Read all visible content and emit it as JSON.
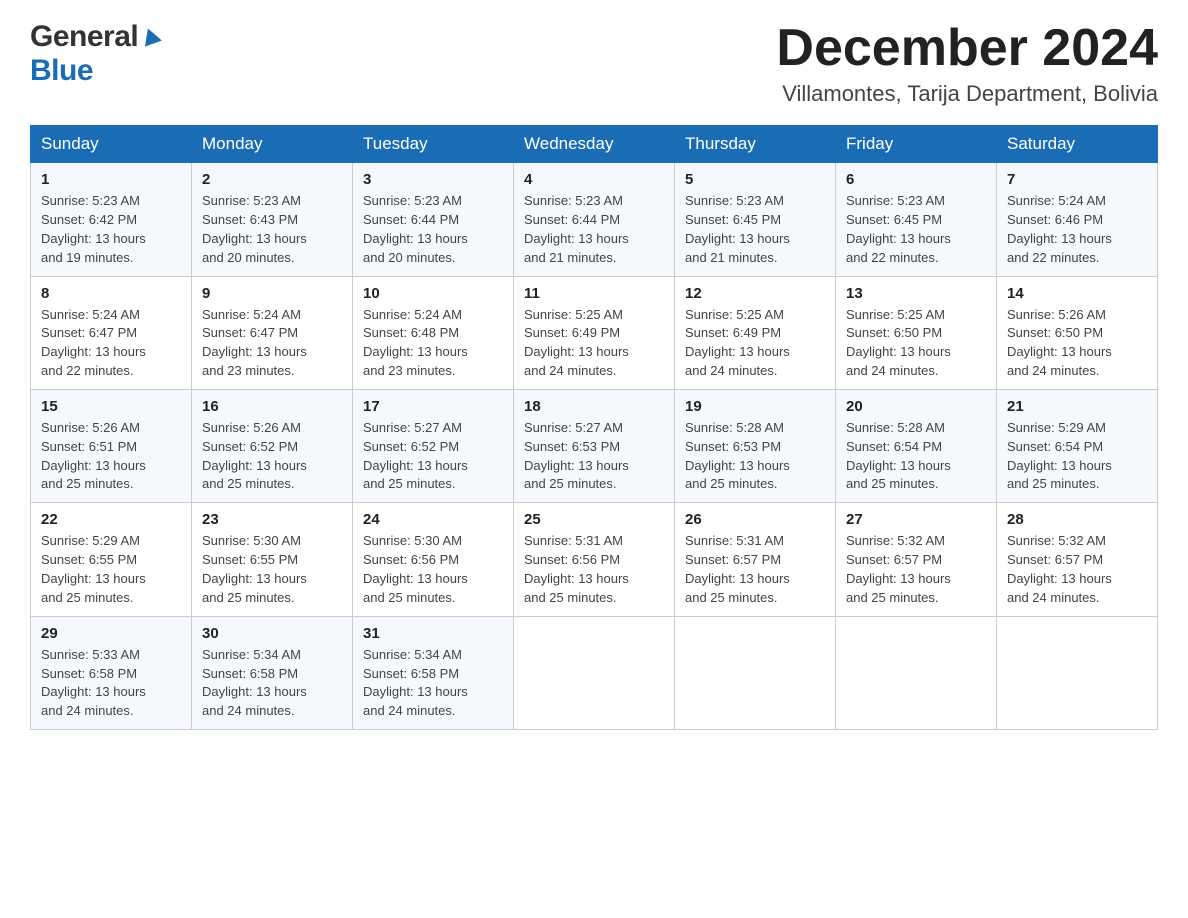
{
  "header": {
    "logo_general": "General",
    "logo_blue": "Blue",
    "month_title": "December 2024",
    "location": "Villamontes, Tarija Department, Bolivia"
  },
  "days_of_week": [
    "Sunday",
    "Monday",
    "Tuesday",
    "Wednesday",
    "Thursday",
    "Friday",
    "Saturday"
  ],
  "weeks": [
    [
      {
        "day": "1",
        "sunrise": "5:23 AM",
        "sunset": "6:42 PM",
        "daylight": "13 hours and 19 minutes."
      },
      {
        "day": "2",
        "sunrise": "5:23 AM",
        "sunset": "6:43 PM",
        "daylight": "13 hours and 20 minutes."
      },
      {
        "day": "3",
        "sunrise": "5:23 AM",
        "sunset": "6:44 PM",
        "daylight": "13 hours and 20 minutes."
      },
      {
        "day": "4",
        "sunrise": "5:23 AM",
        "sunset": "6:44 PM",
        "daylight": "13 hours and 21 minutes."
      },
      {
        "day": "5",
        "sunrise": "5:23 AM",
        "sunset": "6:45 PM",
        "daylight": "13 hours and 21 minutes."
      },
      {
        "day": "6",
        "sunrise": "5:23 AM",
        "sunset": "6:45 PM",
        "daylight": "13 hours and 22 minutes."
      },
      {
        "day": "7",
        "sunrise": "5:24 AM",
        "sunset": "6:46 PM",
        "daylight": "13 hours and 22 minutes."
      }
    ],
    [
      {
        "day": "8",
        "sunrise": "5:24 AM",
        "sunset": "6:47 PM",
        "daylight": "13 hours and 22 minutes."
      },
      {
        "day": "9",
        "sunrise": "5:24 AM",
        "sunset": "6:47 PM",
        "daylight": "13 hours and 23 minutes."
      },
      {
        "day": "10",
        "sunrise": "5:24 AM",
        "sunset": "6:48 PM",
        "daylight": "13 hours and 23 minutes."
      },
      {
        "day": "11",
        "sunrise": "5:25 AM",
        "sunset": "6:49 PM",
        "daylight": "13 hours and 24 minutes."
      },
      {
        "day": "12",
        "sunrise": "5:25 AM",
        "sunset": "6:49 PM",
        "daylight": "13 hours and 24 minutes."
      },
      {
        "day": "13",
        "sunrise": "5:25 AM",
        "sunset": "6:50 PM",
        "daylight": "13 hours and 24 minutes."
      },
      {
        "day": "14",
        "sunrise": "5:26 AM",
        "sunset": "6:50 PM",
        "daylight": "13 hours and 24 minutes."
      }
    ],
    [
      {
        "day": "15",
        "sunrise": "5:26 AM",
        "sunset": "6:51 PM",
        "daylight": "13 hours and 25 minutes."
      },
      {
        "day": "16",
        "sunrise": "5:26 AM",
        "sunset": "6:52 PM",
        "daylight": "13 hours and 25 minutes."
      },
      {
        "day": "17",
        "sunrise": "5:27 AM",
        "sunset": "6:52 PM",
        "daylight": "13 hours and 25 minutes."
      },
      {
        "day": "18",
        "sunrise": "5:27 AM",
        "sunset": "6:53 PM",
        "daylight": "13 hours and 25 minutes."
      },
      {
        "day": "19",
        "sunrise": "5:28 AM",
        "sunset": "6:53 PM",
        "daylight": "13 hours and 25 minutes."
      },
      {
        "day": "20",
        "sunrise": "5:28 AM",
        "sunset": "6:54 PM",
        "daylight": "13 hours and 25 minutes."
      },
      {
        "day": "21",
        "sunrise": "5:29 AM",
        "sunset": "6:54 PM",
        "daylight": "13 hours and 25 minutes."
      }
    ],
    [
      {
        "day": "22",
        "sunrise": "5:29 AM",
        "sunset": "6:55 PM",
        "daylight": "13 hours and 25 minutes."
      },
      {
        "day": "23",
        "sunrise": "5:30 AM",
        "sunset": "6:55 PM",
        "daylight": "13 hours and 25 minutes."
      },
      {
        "day": "24",
        "sunrise": "5:30 AM",
        "sunset": "6:56 PM",
        "daylight": "13 hours and 25 minutes."
      },
      {
        "day": "25",
        "sunrise": "5:31 AM",
        "sunset": "6:56 PM",
        "daylight": "13 hours and 25 minutes."
      },
      {
        "day": "26",
        "sunrise": "5:31 AM",
        "sunset": "6:57 PM",
        "daylight": "13 hours and 25 minutes."
      },
      {
        "day": "27",
        "sunrise": "5:32 AM",
        "sunset": "6:57 PM",
        "daylight": "13 hours and 25 minutes."
      },
      {
        "day": "28",
        "sunrise": "5:32 AM",
        "sunset": "6:57 PM",
        "daylight": "13 hours and 24 minutes."
      }
    ],
    [
      {
        "day": "29",
        "sunrise": "5:33 AM",
        "sunset": "6:58 PM",
        "daylight": "13 hours and 24 minutes."
      },
      {
        "day": "30",
        "sunrise": "5:34 AM",
        "sunset": "6:58 PM",
        "daylight": "13 hours and 24 minutes."
      },
      {
        "day": "31",
        "sunrise": "5:34 AM",
        "sunset": "6:58 PM",
        "daylight": "13 hours and 24 minutes."
      },
      null,
      null,
      null,
      null
    ]
  ],
  "labels": {
    "sunrise_prefix": "Sunrise: ",
    "sunset_prefix": "Sunset: ",
    "daylight_prefix": "Daylight: "
  }
}
